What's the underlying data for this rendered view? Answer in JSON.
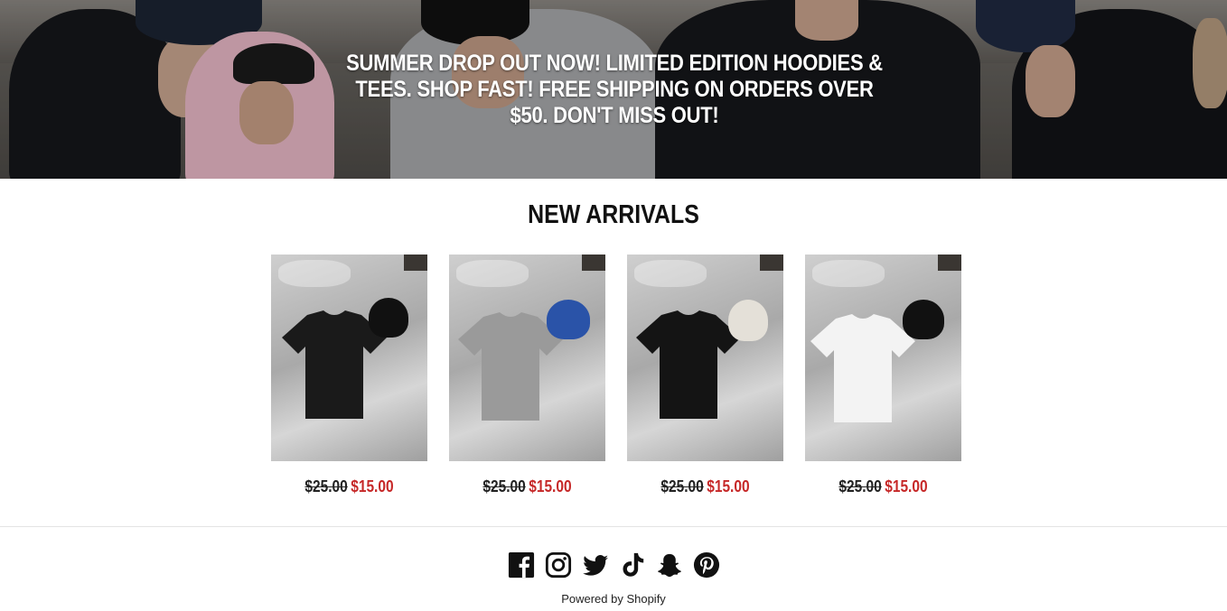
{
  "announcement": {
    "text": "SUMMER DROP OUT NOW! LIMITED EDITION HOODIES & TEES. SHOP FAST! FREE SHIPPING ON ORDERS OVER $50. DON'T MISS OUT!"
  },
  "collection": {
    "title": "NEW ARRIVALS",
    "products": [
      {
        "old_price": "$25.00",
        "sale_price": "$15.00",
        "shirt_color": "#1a1a1a",
        "cap_color": "#111111"
      },
      {
        "old_price": "$25.00",
        "sale_price": "$15.00",
        "shirt_color": "#9a9a9a",
        "cap_color": "#2a53a8"
      },
      {
        "old_price": "$25.00",
        "sale_price": "$15.00",
        "shirt_color": "#141414",
        "cap_color": "#e4e0d8"
      },
      {
        "old_price": "$25.00",
        "sale_price": "$15.00",
        "shirt_color": "#f3f3f3",
        "cap_color": "#111111"
      }
    ]
  },
  "footer": {
    "social_icons": [
      "facebook-icon",
      "instagram-icon",
      "twitter-icon",
      "tiktok-icon",
      "snapchat-icon",
      "pinterest-icon"
    ],
    "powered_by": "Powered by Shopify"
  },
  "colors": {
    "sale": "#c62828",
    "text": "#111111"
  }
}
